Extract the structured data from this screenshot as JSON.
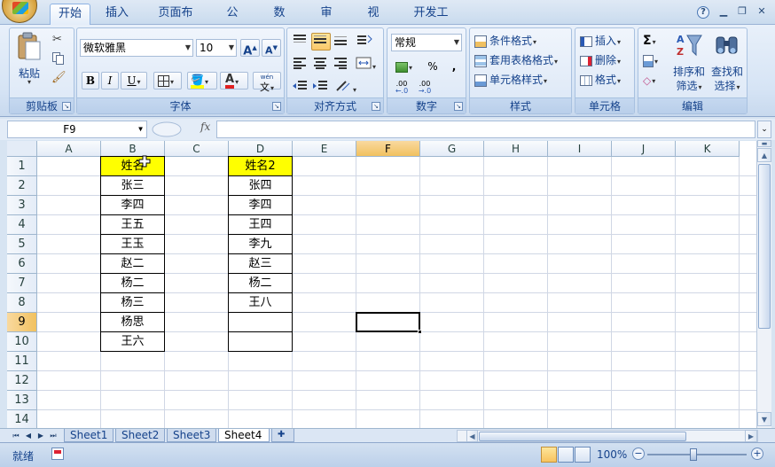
{
  "ribbon_tabs": [
    "开始",
    "插入",
    "页面布局",
    "公式",
    "数据",
    "审阅",
    "视图",
    "开发工具"
  ],
  "clipboard": {
    "paste": "粘贴",
    "label": "剪贴板"
  },
  "font": {
    "name": "微软雅黑",
    "size": "10",
    "bold": "B",
    "italic": "I",
    "underline": "U",
    "phonetic": "wén",
    "phonetic_char": "文",
    "label": "字体",
    "grow": "A",
    "shrink": "A",
    "color_letter": "A"
  },
  "alignment": {
    "label": "对齐方式"
  },
  "number": {
    "format": "常规",
    "percent": "%",
    "comma": ",",
    "inc_decimal": ".00",
    "dec_decimal": ".00",
    "label": "数字"
  },
  "styles": {
    "conditional": "条件格式",
    "table": "套用表格格式",
    "cell_styles": "单元格样式",
    "label": "样式"
  },
  "cells": {
    "insert": "插入",
    "delete": "删除",
    "format": "格式",
    "label": "单元格"
  },
  "editing": {
    "sigma": "Σ",
    "sort_line1": "排序和",
    "sort_line2": "筛选",
    "find_line1": "查找和",
    "find_line2": "选择",
    "label": "编辑"
  },
  "namebox": "F9",
  "fx": "fx",
  "columns": [
    "A",
    "B",
    "C",
    "D",
    "E",
    "F",
    "G",
    "H",
    "I",
    "J",
    "K"
  ],
  "selected_column": "F",
  "rows": [
    "1",
    "2",
    "3",
    "4",
    "5",
    "6",
    "7",
    "8",
    "9",
    "10",
    "11",
    "12",
    "13",
    "14"
  ],
  "selected_row": "9",
  "colB": [
    "姓名",
    "张三",
    "李四",
    "王五",
    "王玉",
    "赵二",
    "杨二",
    "杨三",
    "杨思",
    "王六"
  ],
  "colD": [
    "姓名2",
    "张四",
    "李四",
    "王四",
    "李九",
    "赵三",
    "杨二",
    "王八",
    "",
    ""
  ],
  "sheets": [
    "Sheet1",
    "Sheet2",
    "Sheet3",
    "Sheet4"
  ],
  "active_sheet": "Sheet4",
  "status": "就绪",
  "zoom": "100%",
  "colors": {
    "header_fill": "#ffff00",
    "selected_header": "#f1c15f"
  }
}
